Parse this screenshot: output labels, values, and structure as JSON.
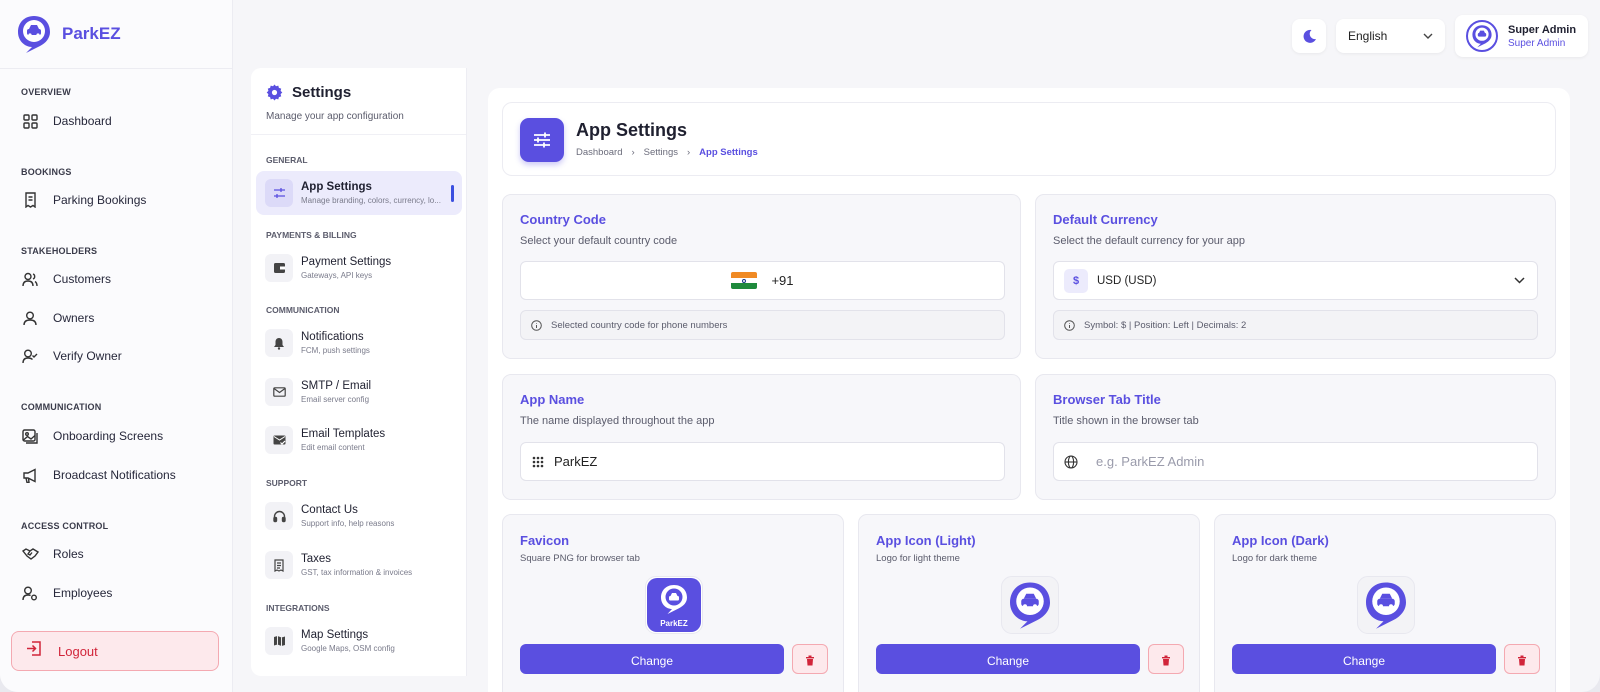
{
  "brand": {
    "name": "ParkEZ"
  },
  "sidebar": {
    "sections": [
      "OVERVIEW",
      "BOOKINGS",
      "STAKEHOLDERS",
      "COMMUNICATION",
      "ACCESS CONTROL"
    ],
    "items": [
      {
        "label": "Dashboard",
        "icon": "grid-icon"
      },
      {
        "label": "Parking Bookings",
        "icon": "receipt-icon"
      },
      {
        "label": "Customers",
        "icon": "users-icon"
      },
      {
        "label": "Owners",
        "icon": "user-icon"
      },
      {
        "label": "Verify Owner",
        "icon": "user-check-icon"
      },
      {
        "label": "Onboarding Screens",
        "icon": "images-icon"
      },
      {
        "label": "Broadcast Notifications",
        "icon": "megaphone-icon"
      },
      {
        "label": "Roles",
        "icon": "handshake-icon"
      },
      {
        "label": "Employees",
        "icon": "user-gear-icon"
      }
    ],
    "logout_label": "Logout"
  },
  "topbar": {
    "language": "English",
    "user_name": "Super Admin",
    "user_role": "Super Admin"
  },
  "settings_nav": {
    "title": "Settings",
    "subtitle": "Manage your app configuration",
    "sections": [
      "GENERAL",
      "PAYMENTS & BILLING",
      "COMMUNICATION",
      "SUPPORT",
      "INTEGRATIONS"
    ],
    "items": [
      {
        "label": "App Settings",
        "desc": "Manage branding, colors, currency, lo...",
        "active": true
      },
      {
        "label": "Payment Settings",
        "desc": "Gateways, API keys"
      },
      {
        "label": "Notifications",
        "desc": "FCM, push settings"
      },
      {
        "label": "SMTP / Email",
        "desc": "Email server config"
      },
      {
        "label": "Email Templates",
        "desc": "Edit email content"
      },
      {
        "label": "Contact Us",
        "desc": "Support info, help reasons"
      },
      {
        "label": "Taxes",
        "desc": "GST, tax information & invoices"
      },
      {
        "label": "Map Settings",
        "desc": "Google Maps, OSM config"
      }
    ]
  },
  "page": {
    "title": "App Settings",
    "breadcrumb": [
      "Dashboard",
      "Settings",
      "App Settings"
    ]
  },
  "country_code": {
    "title": "Country Code",
    "subtitle": "Select your default country code",
    "value": "+91",
    "hint": "Selected country code for phone numbers"
  },
  "default_currency": {
    "title": "Default Currency",
    "subtitle": "Select the default currency for your app",
    "symbol": "$",
    "value": "USD (USD)",
    "hint": "Symbol: $ | Position: Left | Decimals: 2"
  },
  "app_name": {
    "title": "App Name",
    "subtitle": "The name displayed throughout the app",
    "value": "ParkEZ"
  },
  "browser_tab_title": {
    "title": "Browser Tab Title",
    "subtitle": "Title shown in the browser tab",
    "placeholder": "e.g. ParkEZ Admin"
  },
  "favicon": {
    "title": "Favicon",
    "subtitle": "Square PNG for browser tab",
    "logo_text": "ParkEZ",
    "change_label": "Change"
  },
  "app_icon_light": {
    "title": "App Icon (Light)",
    "subtitle": "Logo for light theme",
    "change_label": "Change"
  },
  "app_icon_dark": {
    "title": "App Icon (Dark)",
    "subtitle": "Logo for dark theme",
    "change_label": "Change"
  },
  "colors": {
    "accent": "#5a4fe0",
    "danger": "#d1253a",
    "flag_saffron": "#f08a24",
    "flag_white": "#ffffff",
    "flag_green": "#1e8a3c"
  }
}
